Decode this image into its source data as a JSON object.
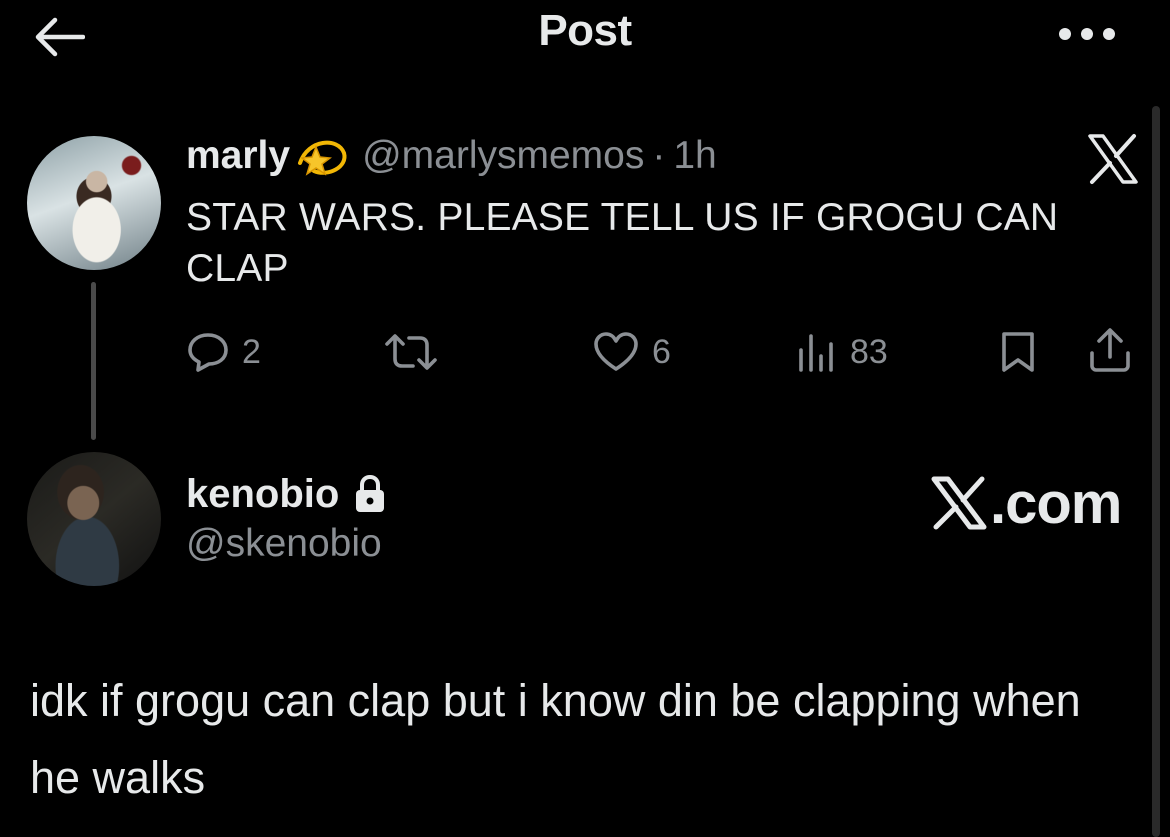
{
  "header": {
    "title": "Post"
  },
  "quoted_post": {
    "display_name": "marly",
    "name_emoji": "💫",
    "handle": "@marlysmemos",
    "separator": "·",
    "time": "1h",
    "text": "STAR WARS. PLEASE TELL US IF GROGU CAN CLAP",
    "actions": {
      "replies": "2",
      "retweets": "",
      "likes": "6",
      "views": "83"
    }
  },
  "reply": {
    "display_name": "kenobio",
    "handle": "@skenobio",
    "watermark_suffix": ".com",
    "text": "idk if grogu can clap but i know din be clapping when he walks"
  },
  "icons": {
    "back": "arrow-left-icon",
    "more": "more-horizontal-icon",
    "reply": "speech-bubble-icon",
    "retweet": "retweet-icon",
    "like": "heart-icon",
    "views": "bar-chart-icon",
    "bookmark": "bookmark-icon",
    "share": "share-icon",
    "lock": "lock-icon",
    "x_logo": "x-logo-icon"
  },
  "colors": {
    "background": "#000000",
    "primary_text": "#e7e9ea",
    "secondary_text": "#8b8f94",
    "thread_line": "#4a4a4a"
  }
}
